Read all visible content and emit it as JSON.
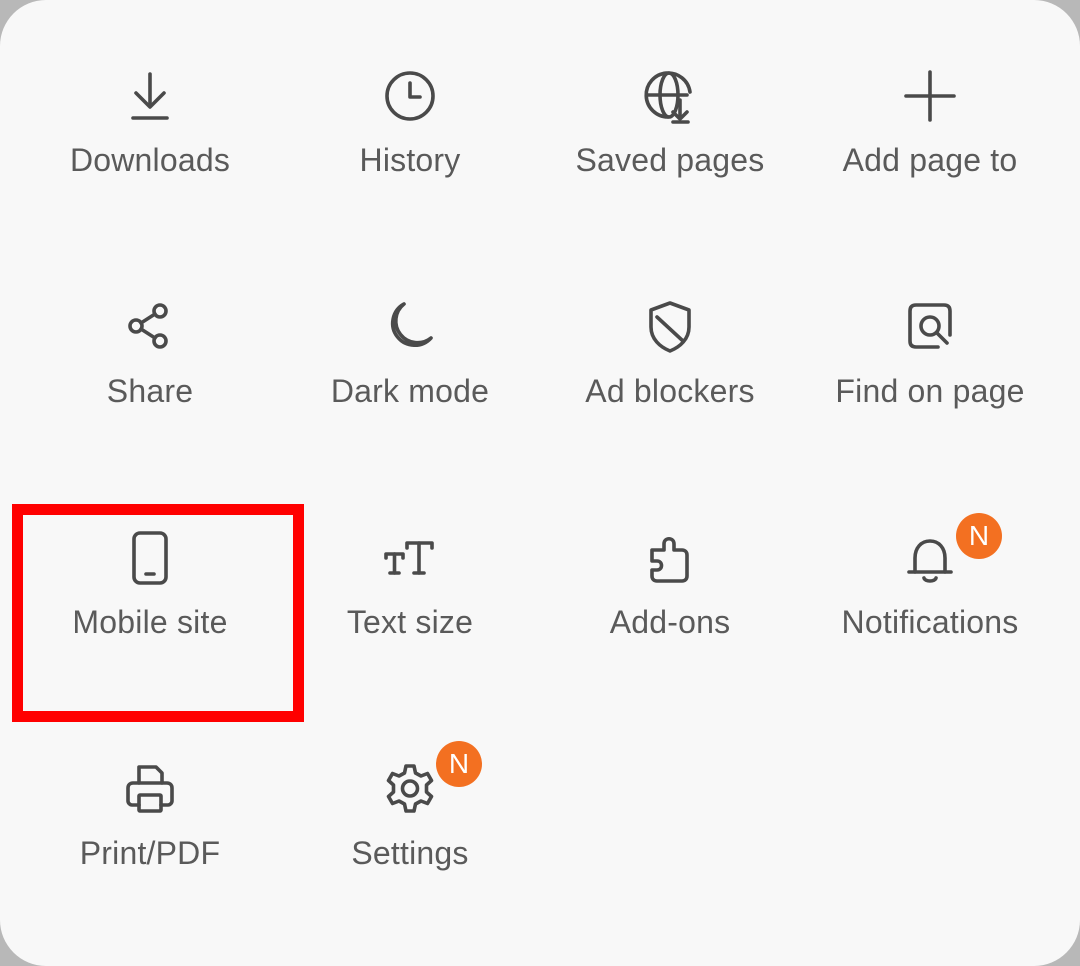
{
  "menu": {
    "items": [
      {
        "label": "Downloads",
        "icon": "download-icon"
      },
      {
        "label": "History",
        "icon": "clock-icon"
      },
      {
        "label": "Saved pages",
        "icon": "globe-download-icon"
      },
      {
        "label": "Add page to",
        "icon": "plus-icon"
      },
      {
        "label": "Share",
        "icon": "share-icon"
      },
      {
        "label": "Dark mode",
        "icon": "moon-icon"
      },
      {
        "label": "Ad blockers",
        "icon": "shield-icon"
      },
      {
        "label": "Find on page",
        "icon": "find-page-icon"
      },
      {
        "label": "Mobile site",
        "icon": "phone-icon"
      },
      {
        "label": "Text size",
        "icon": "text-size-icon"
      },
      {
        "label": "Add-ons",
        "icon": "puzzle-icon"
      },
      {
        "label": "Notifications",
        "icon": "bell-icon",
        "badge": "N"
      },
      {
        "label": "Print/PDF",
        "icon": "printer-icon"
      },
      {
        "label": "Settings",
        "icon": "gear-icon",
        "badge": "N"
      }
    ]
  },
  "colors": {
    "background": "#f8f8f8",
    "label": "#5a5a5a",
    "icon": "#4a4a4a",
    "badge": "#f37021",
    "highlight": "#ff0000"
  }
}
